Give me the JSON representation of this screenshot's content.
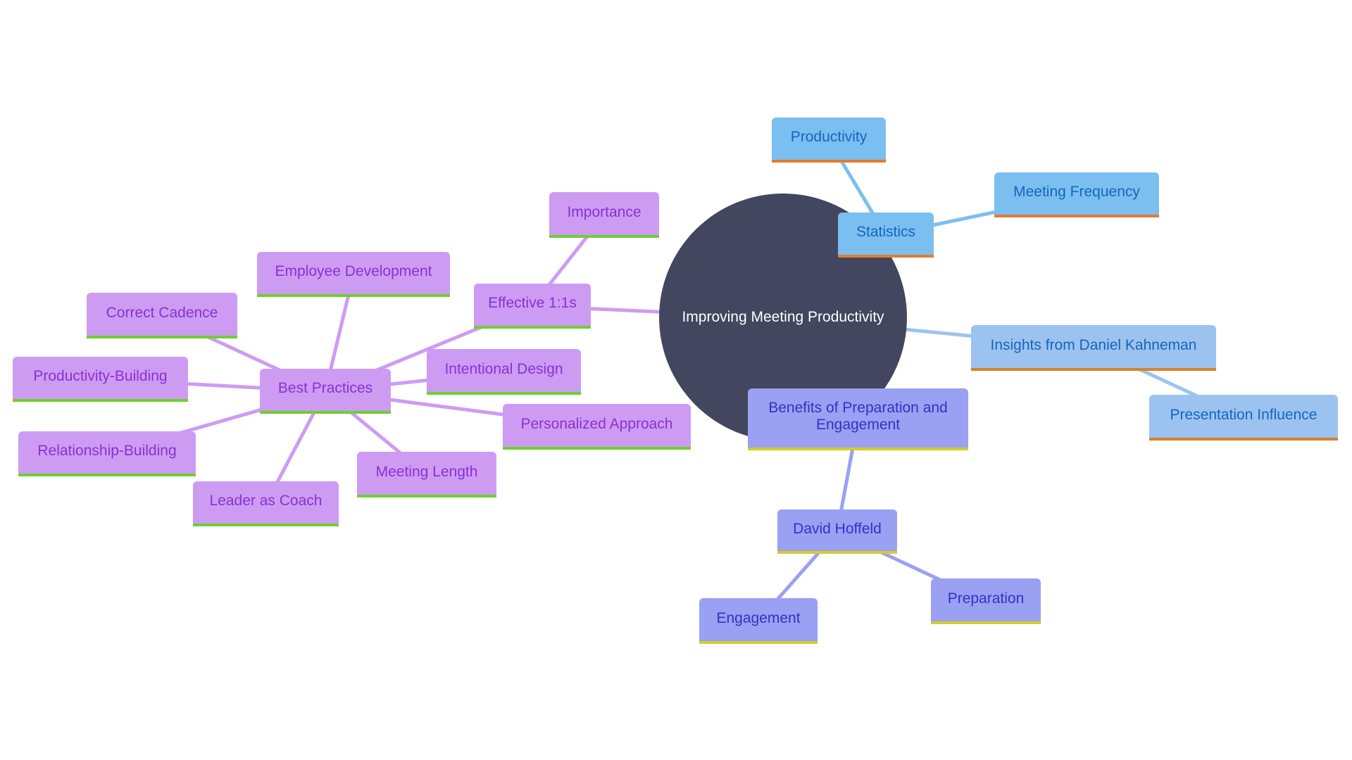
{
  "diagram": {
    "type": "mindmap",
    "root": {
      "id": "root",
      "label": "Improving Meeting Productivity",
      "color": "#42465e",
      "text_color": "#ffffff"
    },
    "branch_styles": {
      "purple": {
        "fill": "#cd9cf2",
        "text": "#8a2fd6",
        "underline": "#6fcf2f",
        "edge": "#cd9cf2"
      },
      "blue": {
        "fill": "#7bbff0",
        "text": "#1565c0",
        "underline": "#e57b2e",
        "edge": "#7bbff0"
      },
      "lightblue": {
        "fill": "#9cc3ef",
        "text": "#1565c0",
        "underline": "#d6822c",
        "edge": "#9cc3ef"
      },
      "indigo": {
        "fill": "#9aa0f2",
        "text": "#2f33c4",
        "underline": "#d4cd2a",
        "edge": "#9aa0f2"
      }
    },
    "nodes": [
      {
        "id": "statistics",
        "label": "Statistics",
        "parent": "root",
        "style": "blue"
      },
      {
        "id": "productivity",
        "label": "Productivity",
        "parent": "statistics",
        "style": "blue"
      },
      {
        "id": "meeting-frequency",
        "label": "Meeting Frequency",
        "parent": "statistics",
        "style": "blue"
      },
      {
        "id": "insights",
        "label": "Insights from Daniel Kahneman",
        "parent": "root",
        "style": "lightblue"
      },
      {
        "id": "presentation-influence",
        "label": "Presentation Influence",
        "parent": "insights",
        "style": "lightblue"
      },
      {
        "id": "benefits",
        "label": "Benefits of Preparation and Engagement",
        "parent": "root",
        "style": "indigo"
      },
      {
        "id": "david-hoffeld",
        "label": "David Hoffeld",
        "parent": "benefits",
        "style": "indigo"
      },
      {
        "id": "preparation",
        "label": "Preparation",
        "parent": "david-hoffeld",
        "style": "indigo"
      },
      {
        "id": "engagement",
        "label": "Engagement",
        "parent": "david-hoffeld",
        "style": "indigo"
      },
      {
        "id": "effective-1-1s",
        "label": "Effective 1:1s",
        "parent": "root",
        "style": "purple"
      },
      {
        "id": "importance",
        "label": "Importance",
        "parent": "effective-1-1s",
        "style": "purple"
      },
      {
        "id": "best-practices",
        "label": "Best Practices",
        "parent": "effective-1-1s",
        "style": "purple"
      },
      {
        "id": "employee-development",
        "label": "Employee Development",
        "parent": "best-practices",
        "style": "purple"
      },
      {
        "id": "correct-cadence",
        "label": "Correct Cadence",
        "parent": "best-practices",
        "style": "purple"
      },
      {
        "id": "productivity-building",
        "label": "Productivity-Building",
        "parent": "best-practices",
        "style": "purple"
      },
      {
        "id": "relationship-building",
        "label": "Relationship-Building",
        "parent": "best-practices",
        "style": "purple"
      },
      {
        "id": "leader-as-coach",
        "label": "Leader as Coach",
        "parent": "best-practices",
        "style": "purple"
      },
      {
        "id": "meeting-length",
        "label": "Meeting Length",
        "parent": "best-practices",
        "style": "purple"
      },
      {
        "id": "intentional-design",
        "label": "Intentional Design",
        "parent": "best-practices",
        "style": "purple"
      },
      {
        "id": "personalized-approach",
        "label": "Personalized Approach",
        "parent": "best-practices",
        "style": "purple"
      }
    ]
  }
}
